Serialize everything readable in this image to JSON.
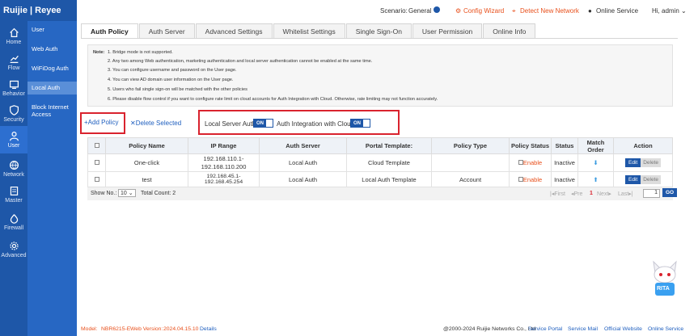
{
  "brand": {
    "logo_text": "Ruijie | Reyee"
  },
  "nav": {
    "items": [
      {
        "label": "Home",
        "icon": "home-icon"
      },
      {
        "label": "Flow",
        "icon": "chart-icon"
      },
      {
        "label": "Behavior",
        "icon": "behavior-icon"
      },
      {
        "label": "Security",
        "icon": "shield-icon"
      },
      {
        "label": "User",
        "icon": "user-icon"
      },
      {
        "label": "Network",
        "icon": "globe-icon"
      },
      {
        "label": "Master",
        "icon": "master-icon"
      },
      {
        "label": "Firewall",
        "icon": "firewall-icon"
      },
      {
        "label": "Advanced",
        "icon": "gear-icon"
      }
    ],
    "active": "User"
  },
  "subnav": {
    "items": [
      {
        "label": "User"
      },
      {
        "label": "Web Auth"
      },
      {
        "label": "WiFiDog Auth"
      },
      {
        "label": "Local Auth"
      },
      {
        "label": "Block Internet Access"
      }
    ],
    "active": "Local Auth"
  },
  "topbar": {
    "scenario_label": "Scenario:",
    "scenario_value": "General",
    "config_wizard": "Config Wizard",
    "detect_network": "Detect New Network",
    "online_service": "Online Service",
    "greeting": "Hi, admin"
  },
  "tabs": [
    {
      "label": "Auth Policy"
    },
    {
      "label": "Auth Server"
    },
    {
      "label": "Advanced Settings"
    },
    {
      "label": "Whitelist Settings"
    },
    {
      "label": "Single Sign-On"
    },
    {
      "label": "User Permission"
    },
    {
      "label": "Online Info"
    }
  ],
  "notes": {
    "heading": "Note:",
    "lines": [
      "1. Bridge mode is not supported.",
      "2. Any two among Web authentication, marketing authentication and local server authentication cannot be enabled at the same time.",
      "3. You can configure username and password on the User page.",
      "4. You can view AD domain user information on the User page.",
      "5. Users who fail single sign-on will be matched with the other policies",
      "6. Please disable flow control if you want to configure rate limit on cloud accounts for Auth Integration with Cloud. Otherwise, rate limiting may not function accurately."
    ]
  },
  "actions": {
    "add_policy": "Add Policy",
    "delete_selected": "Delete Selected",
    "local_server_auth_label": "Local Server Auth:",
    "local_server_auth_state": "ON",
    "cloud_auth_label": "Auth Integration with Cloud:",
    "cloud_auth_state": "ON"
  },
  "table": {
    "headers": [
      "",
      "Policy Name",
      "IP Range",
      "Auth Server",
      "Portal Template:",
      "Policy Type",
      "Policy Status",
      "Status",
      "Match Order",
      "Action"
    ],
    "rows": [
      {
        "name": "One-click",
        "ip_range": "192.168.110.1-192.168.110.200",
        "auth_server": "Local Auth",
        "portal_template": "Cloud Template",
        "policy_type": "",
        "policy_status": "Enable",
        "status": "Inactive",
        "edit": "Edit",
        "delete": "Delete"
      },
      {
        "name": "test",
        "ip_range": "192.168.45.1-192.168.45.254",
        "auth_server": "Local Auth",
        "portal_template": "Local Auth Template",
        "policy_type": "Account",
        "policy_status": "Enable",
        "status": "Inactive",
        "edit": "Edit",
        "delete": "Delete"
      }
    ]
  },
  "pager": {
    "show_no_label": "Show No.:",
    "page_size": "10",
    "total_count": "Total Count: 2",
    "first": "First",
    "prev": "Pre",
    "current_page": "1",
    "next": "Next",
    "last": "Last",
    "page_input": "1",
    "go": "GO"
  },
  "footer": {
    "model_label": "Model:",
    "model_value": "NBR6215-E",
    "web_version_label": "Web Version:",
    "web_version_value": "2024.04.15.10",
    "details": "Details",
    "copyright": "@2000-2024 Ruijie Networks Co., Ltd",
    "service_portal": "Service Portal",
    "service_mail": "Service Mail",
    "official_website": "Official Website",
    "online_service": "Online Service"
  },
  "assistant": {
    "label": "RITA"
  },
  "colors": {
    "primary": "#1e57a8",
    "accent": "#e8501c",
    "highlight_box": "#d9232e"
  }
}
